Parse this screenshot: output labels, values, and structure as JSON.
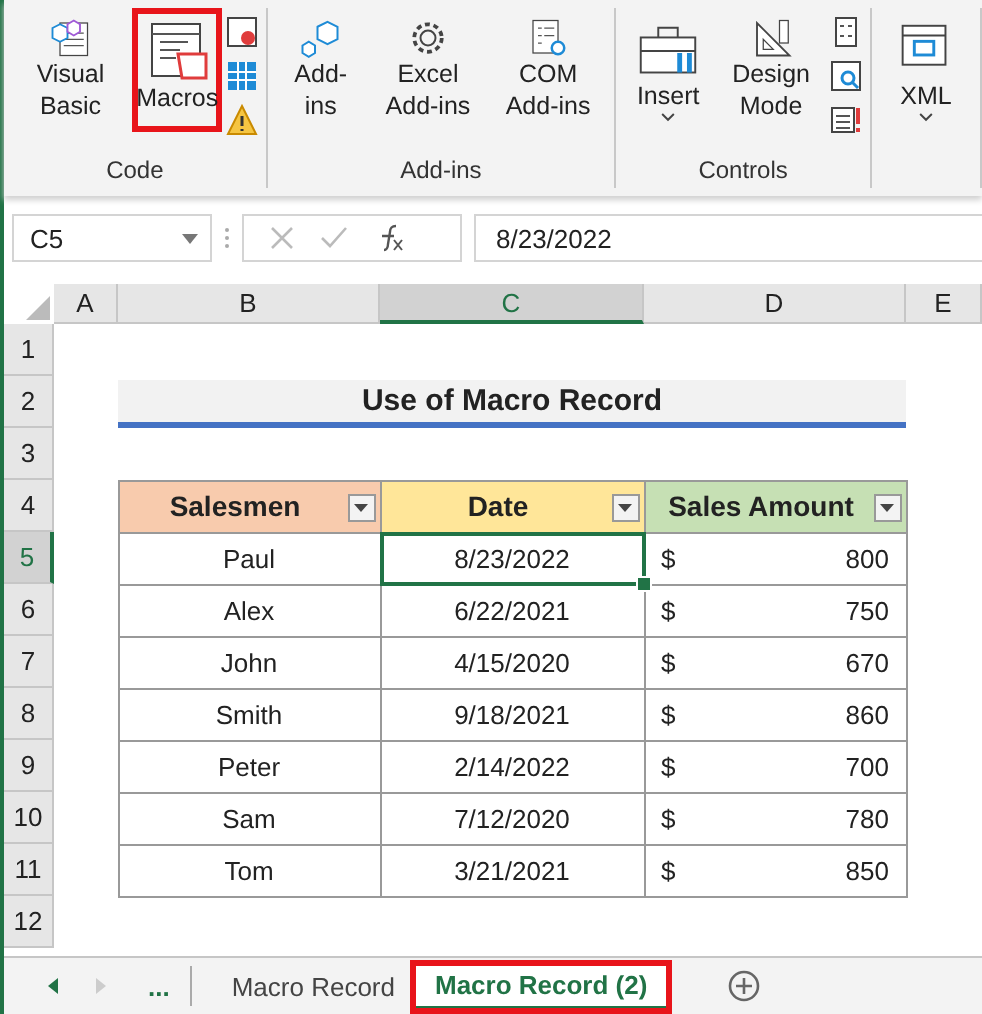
{
  "ribbon": {
    "groups": [
      {
        "label": "Code",
        "buttons": [
          {
            "kind": "large",
            "label": "Visual Basic",
            "highlighted": false,
            "dropdown": false
          },
          {
            "kind": "large",
            "label": "Macros",
            "highlighted": true,
            "dropdown": false
          },
          {
            "kind": "smallstack"
          }
        ]
      },
      {
        "label": "Add-ins",
        "buttons": [
          {
            "kind": "large",
            "label": "Add-ins",
            "highlighted": false,
            "dropdown": false
          },
          {
            "kind": "large",
            "label": "Excel Add-ins",
            "highlighted": false,
            "dropdown": false
          },
          {
            "kind": "large",
            "label": "COM Add-ins",
            "highlighted": false,
            "dropdown": false
          }
        ]
      },
      {
        "label": "Controls",
        "buttons": [
          {
            "kind": "large",
            "label": "Insert",
            "highlighted": false,
            "dropdown": true
          },
          {
            "kind": "large",
            "label": "Design Mode",
            "highlighted": false,
            "dropdown": false
          },
          {
            "kind": "smallstack"
          }
        ]
      },
      {
        "buttons": [
          {
            "kind": "large",
            "label": "XML",
            "highlighted": false,
            "dropdown": true
          }
        ]
      }
    ]
  },
  "formula_bar": {
    "name_box": "C5",
    "value": "8/23/2022"
  },
  "columns": [
    {
      "label": "A",
      "selected": false
    },
    {
      "label": "B",
      "selected": false
    },
    {
      "label": "C",
      "selected": true
    },
    {
      "label": "D",
      "selected": false
    },
    {
      "label": "E",
      "selected": false
    }
  ],
  "rows": [
    {
      "label": "1",
      "selected": false
    },
    {
      "label": "2",
      "selected": false
    },
    {
      "label": "3",
      "selected": false
    },
    {
      "label": "4",
      "selected": false
    },
    {
      "label": "5",
      "selected": true
    },
    {
      "label": "6",
      "selected": false
    },
    {
      "label": "7",
      "selected": false
    },
    {
      "label": "8",
      "selected": false
    },
    {
      "label": "9",
      "selected": false
    },
    {
      "label": "10",
      "selected": false
    },
    {
      "label": "11",
      "selected": false
    },
    {
      "label": "12",
      "selected": false
    }
  ],
  "title": "Use of Macro Record",
  "table": {
    "columns": [
      {
        "label": "Salesmen",
        "color": "#f8cbad"
      },
      {
        "label": "Date",
        "color": "#ffe699"
      },
      {
        "label": "Sales Amount",
        "color": "#c6e0b4"
      }
    ],
    "rows": [
      {
        "salesman": "Paul",
        "date": "8/23/2022",
        "currency": "$",
        "amount": "800",
        "selected": true
      },
      {
        "salesman": "Alex",
        "date": "6/22/2021",
        "currency": "$",
        "amount": "750",
        "selected": false
      },
      {
        "salesman": "John",
        "date": "4/15/2020",
        "currency": "$",
        "amount": "670",
        "selected": false
      },
      {
        "salesman": "Smith",
        "date": "9/18/2021",
        "currency": "$",
        "amount": "860",
        "selected": false
      },
      {
        "salesman": "Peter",
        "date": "2/14/2022",
        "currency": "$",
        "amount": "700",
        "selected": false
      },
      {
        "salesman": "Sam",
        "date": "7/12/2020",
        "currency": "$",
        "amount": "780",
        "selected": false
      },
      {
        "salesman": "Tom",
        "date": "3/21/2021",
        "currency": "$",
        "amount": "850",
        "selected": false
      }
    ]
  },
  "sheet_tabs": {
    "overflow": "...",
    "tabs": [
      {
        "label": "Macro Record",
        "selected": false,
        "highlighted": false
      },
      {
        "label": "Macro Record (2)",
        "selected": true,
        "highlighted": true
      }
    ]
  }
}
